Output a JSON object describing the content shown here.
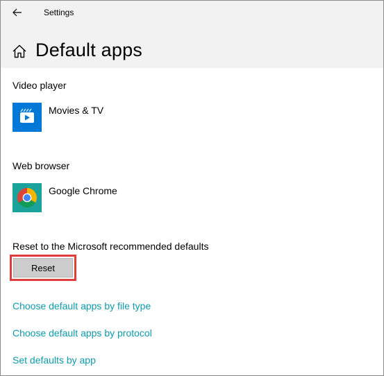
{
  "window": {
    "title": "Settings"
  },
  "header": {
    "title": "Default apps"
  },
  "video_player": {
    "label": "Video player",
    "app": {
      "name": "Movies & TV",
      "icon": "movies-tv-icon",
      "tile_color": "#0078d7"
    }
  },
  "web_browser": {
    "label": "Web browser",
    "app": {
      "name": "Google Chrome",
      "icon": "google-chrome-icon",
      "tile_color": "#1aa39a"
    }
  },
  "reset": {
    "label": "Reset to the Microsoft recommended defaults",
    "button_label": "Reset",
    "highlight_color": "#e03c3c"
  },
  "links": [
    {
      "label": "Choose default apps by file type"
    },
    {
      "label": "Choose default apps by protocol"
    },
    {
      "label": "Set defaults by app"
    }
  ],
  "colors": {
    "link": "#0b9db1",
    "header_bg": "#f2f2f2"
  }
}
